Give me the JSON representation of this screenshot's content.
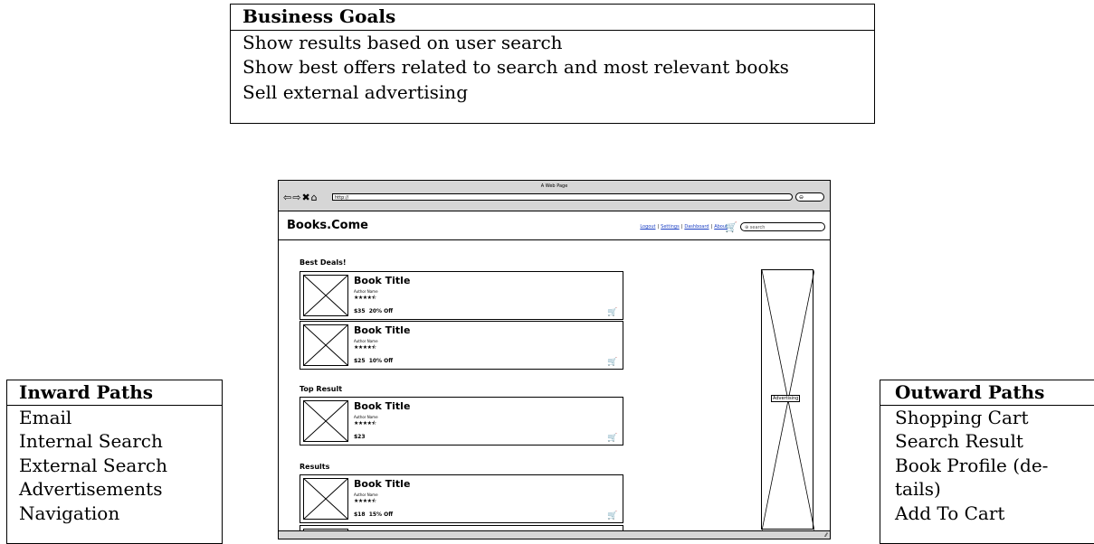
{
  "business_goals": {
    "header": "Business Goals",
    "items": [
      "Show results based on user search",
      "Show best offers related to search and most relevant books",
      "Sell external advertising"
    ]
  },
  "inward_paths": {
    "header": "Inward Paths",
    "items": [
      "Email",
      "Internal Search",
      "External Search",
      "Advertisements",
      "Navigation"
    ]
  },
  "outward_paths": {
    "header": "Outward Paths",
    "items": [
      "Shopping Cart",
      "Search Result",
      "Book Profile (de-",
      "tails)",
      "Add To Cart"
    ]
  },
  "wireframe": {
    "window_title": "A Web Page",
    "url": "http://",
    "brand": "Books.Come",
    "links": [
      "Logout",
      "Settings",
      "Dashboard",
      "About"
    ],
    "search_placeholder": "search",
    "sections": {
      "best_deals": "Best Deals!",
      "top_result": "Top Result",
      "results": "Results"
    },
    "cards": [
      {
        "title": "Book Title",
        "author": "Author Name",
        "rating": 4.5,
        "stars": "★★★★⯪",
        "price": "$35  20% Off"
      },
      {
        "title": "Book Title",
        "author": "Author Name",
        "rating": 4.5,
        "stars": "★★★★⯪",
        "price": "$25  10% Off"
      },
      {
        "title": "Book Title",
        "author": "Author Name",
        "rating": 4.5,
        "stars": "★★★★⯪",
        "price": "$23"
      },
      {
        "title": "Book Title",
        "author": "Author Name",
        "rating": 4.5,
        "stars": "★★★★⯪",
        "price": "$18  15% Off"
      }
    ],
    "advertising_label": "Advertising"
  }
}
